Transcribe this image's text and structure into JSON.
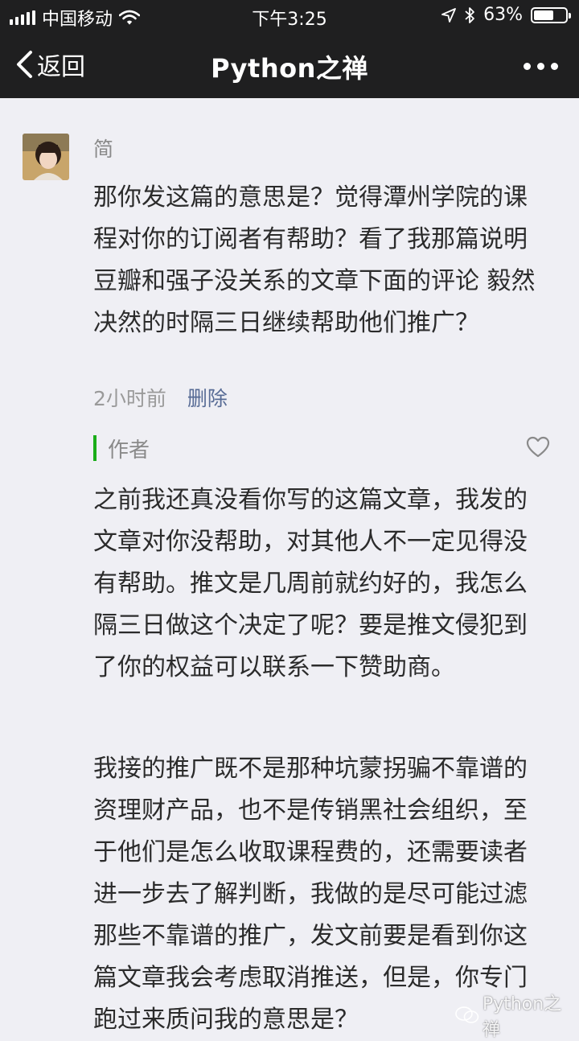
{
  "status_bar": {
    "carrier": "中国移动",
    "time": "下午3:25",
    "battery_percent": "63%",
    "battery_level": 0.63
  },
  "nav": {
    "back_label": "返回",
    "title": "Python之禅"
  },
  "comment": {
    "user_name": "简",
    "text": "那你发这篇的意思是？觉得潭州学院的课程对你的订阅者有帮助？看了我那篇说明豆瓣和强子没关系的文章下面的评论 毅然决然的时隔三日继续帮助他们推广？",
    "time_ago": "2小时前",
    "delete_label": "删除"
  },
  "reply": {
    "author_label": "作者",
    "paragraph1": "之前我还真没看你写的这篇文章，我发的文章对你没帮助，对其他人不一定见得没有帮助。推文是几周前就约好的，我怎么隔三日做这个决定了呢？要是推文侵犯到了你的权益可以联系一下赞助商。",
    "paragraph2": "我接的推广既不是那种坑蒙拐骗不靠谱的资理财产品，也不是传销黑社会组织，至于他们是怎么收取课程费的，还需要读者进一步去了解判断，我做的是尽可能过滤那些不靠谱的推广，发文前要是看到你这篇文章我会考虑取消推送，但是，你专门跑过来质问我的意思是？"
  },
  "watermark": "Python之禅",
  "icons": {
    "back": "chevron-left-icon",
    "more": "more-dots-icon",
    "like": "heart-icon",
    "wifi": "wifi-icon",
    "location": "location-arrow-icon",
    "bluetooth": "bluetooth-icon",
    "battery": "battery-icon",
    "signal": "signal-bars-icon"
  },
  "colors": {
    "bar_background": "#1f1f20",
    "page_background": "#efeff4",
    "link": "#576b95",
    "author_accent": "#1aad19"
  }
}
